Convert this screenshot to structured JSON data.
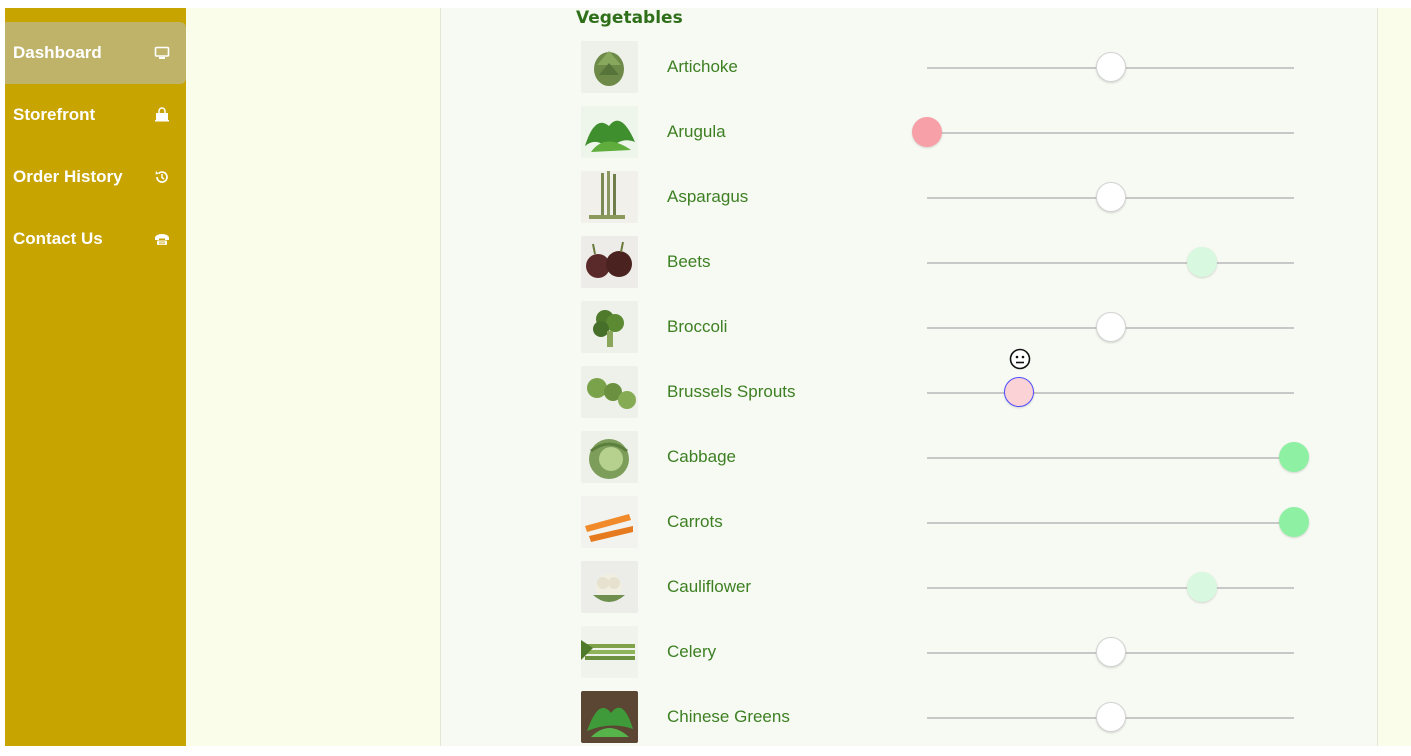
{
  "sidebar": {
    "items": [
      {
        "label": "Dashboard",
        "icon": "monitor-icon",
        "active": true
      },
      {
        "label": "Storefront",
        "icon": "shopping-bag-icon",
        "active": false
      },
      {
        "label": "Order History",
        "icon": "history-icon",
        "active": false
      },
      {
        "label": "Contact Us",
        "icon": "telephone-icon",
        "active": false
      }
    ]
  },
  "section_title": "Vegetables",
  "vegetables": [
    {
      "name": "Artichoke",
      "level": 0.5,
      "knob_color": "#ffffff"
    },
    {
      "name": "Arugula",
      "level": 0.0,
      "knob_color": "#f7a0a8"
    },
    {
      "name": "Asparagus",
      "level": 0.5,
      "knob_color": "#ffffff"
    },
    {
      "name": "Beets",
      "level": 0.75,
      "knob_color": "#d8f8df"
    },
    {
      "name": "Broccoli",
      "level": 0.5,
      "knob_color": "#ffffff"
    },
    {
      "name": "Brussels Sprouts",
      "level": 0.25,
      "knob_color": "#fbd3d6",
      "focused": true,
      "mood_icon": "neutral-face-icon"
    },
    {
      "name": "Cabbage",
      "level": 1.0,
      "knob_color": "#8ef0a3"
    },
    {
      "name": "Carrots",
      "level": 1.0,
      "knob_color": "#8ef0a3"
    },
    {
      "name": "Cauliflower",
      "level": 0.75,
      "knob_color": "#d8f8df"
    },
    {
      "name": "Celery",
      "level": 0.5,
      "knob_color": "#ffffff"
    },
    {
      "name": "Chinese Greens",
      "level": 0.5,
      "knob_color": "#ffffff"
    }
  ]
}
